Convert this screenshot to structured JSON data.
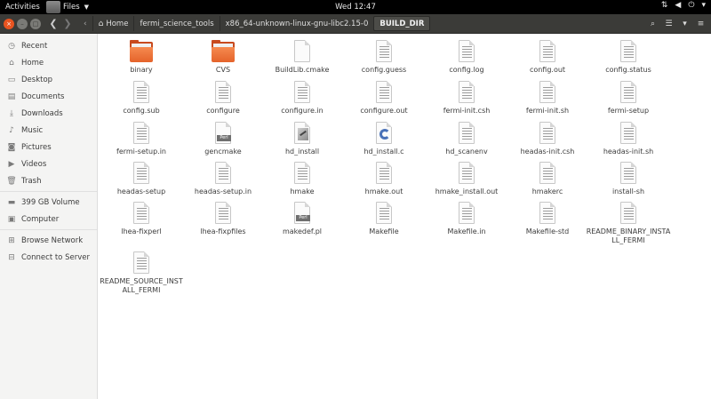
{
  "topbar": {
    "activities": "Activities",
    "app_name": "Files",
    "clock": "Wed 12:47"
  },
  "window_controls": {
    "close": "×",
    "minimize": "–",
    "maximize": "□"
  },
  "breadcrumbs": [
    {
      "label": "Home"
    },
    {
      "label": "fermi_science_tools"
    },
    {
      "label": "x86_64-unknown-linux-gnu-libc2.15-0"
    },
    {
      "label": "BUILD_DIR"
    }
  ],
  "sidebar": {
    "items": [
      {
        "label": "Recent",
        "icon": "clock-icon"
      },
      {
        "label": "Home",
        "icon": "home-icon"
      },
      {
        "label": "Desktop",
        "icon": "desktop-icon"
      },
      {
        "label": "Documents",
        "icon": "documents-icon"
      },
      {
        "label": "Downloads",
        "icon": "download-icon"
      },
      {
        "label": "Music",
        "icon": "music-icon"
      },
      {
        "label": "Pictures",
        "icon": "camera-icon"
      },
      {
        "label": "Videos",
        "icon": "video-icon"
      },
      {
        "label": "Trash",
        "icon": "trash-icon"
      },
      {
        "label": "399 GB Volume",
        "icon": "drive-icon"
      },
      {
        "label": "Computer",
        "icon": "computer-icon"
      },
      {
        "label": "Browse Network",
        "icon": "network-icon"
      },
      {
        "label": "Connect to Server",
        "icon": "server-icon"
      }
    ]
  },
  "files": [
    {
      "name": "binary",
      "type": "folder"
    },
    {
      "name": "CVS",
      "type": "folder"
    },
    {
      "name": "BuildLib.cmake",
      "type": "blank"
    },
    {
      "name": "config.guess",
      "type": "text"
    },
    {
      "name": "config.log",
      "type": "text"
    },
    {
      "name": "config.out",
      "type": "text"
    },
    {
      "name": "config.status",
      "type": "text"
    },
    {
      "name": "config.sub",
      "type": "text"
    },
    {
      "name": "configure",
      "type": "text"
    },
    {
      "name": "configure.in",
      "type": "text"
    },
    {
      "name": "configure.out",
      "type": "text"
    },
    {
      "name": "fermi-init.csh",
      "type": "text"
    },
    {
      "name": "fermi-init.sh",
      "type": "text"
    },
    {
      "name": "fermi-setup",
      "type": "text"
    },
    {
      "name": "fermi-setup.in",
      "type": "text"
    },
    {
      "name": "gencmake",
      "type": "perl",
      "badge": "Perl"
    },
    {
      "name": "hd_install",
      "type": "exec"
    },
    {
      "name": "hd_install.c",
      "type": "csource"
    },
    {
      "name": "hd_scanenv",
      "type": "text"
    },
    {
      "name": "headas-init.csh",
      "type": "text"
    },
    {
      "name": "headas-init.sh",
      "type": "text"
    },
    {
      "name": "headas-setup",
      "type": "text"
    },
    {
      "name": "headas-setup.in",
      "type": "text"
    },
    {
      "name": "hmake",
      "type": "text"
    },
    {
      "name": "hmake.out",
      "type": "text"
    },
    {
      "name": "hmake_install.out",
      "type": "text"
    },
    {
      "name": "hmakerc",
      "type": "text"
    },
    {
      "name": "install-sh",
      "type": "text"
    },
    {
      "name": "lhea-fixperl",
      "type": "text"
    },
    {
      "name": "lhea-fixpfiles",
      "type": "text"
    },
    {
      "name": "makedef.pl",
      "type": "perl",
      "badge": "Perl"
    },
    {
      "name": "Makefile",
      "type": "text"
    },
    {
      "name": "Makefile.in",
      "type": "text"
    },
    {
      "name": "Makefile-std",
      "type": "text"
    },
    {
      "name": "README_BINARY_INSTALL_FERMI",
      "type": "text"
    },
    {
      "name": "README_SOURCE_INSTALL_FERMI",
      "type": "text"
    }
  ]
}
